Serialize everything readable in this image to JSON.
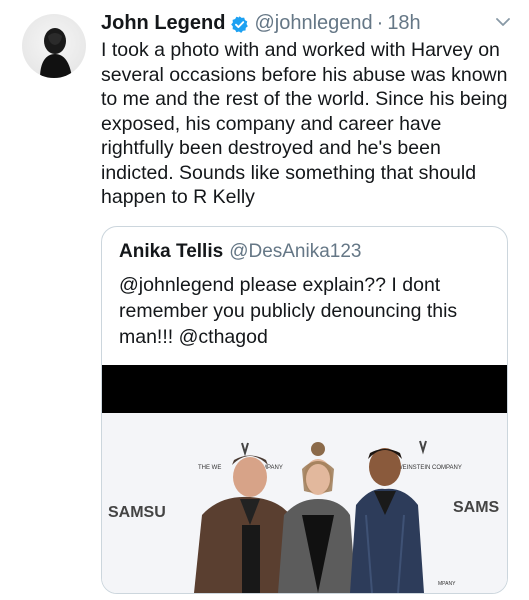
{
  "tweet": {
    "author_name": "John Legend",
    "author_handle": "@johnlegend",
    "separator": "·",
    "time": "18h",
    "text": "I took a photo with and worked with Harvey on several occasions before his abuse was known to me and the rest of the world. Since his being exposed, his company and career have rightfully been destroyed and he's been indicted. Sounds like something that should happen to R Kelly"
  },
  "quoted": {
    "author_name": "Anika Tellis",
    "author_handle": "@DesAnika123",
    "text": "@johnlegend please explain?? I dont remember you publicly denouncing this man!!! @cthagod",
    "photo": {
      "backdrop_logos": [
        "THE WE",
        "MPANY",
        "WEINSTEIN COMPANY",
        "MPANY"
      ],
      "backdrop_sponsor_left": "SAMSU",
      "backdrop_sponsor_right": "SAMS"
    }
  },
  "icons": [
    "avatar",
    "verified-badge-icon",
    "chevron-down-icon"
  ],
  "colors": {
    "text": "#14171a",
    "secondary": "#657786",
    "verified": "#1da1f2",
    "border": "#ccd6dd"
  }
}
